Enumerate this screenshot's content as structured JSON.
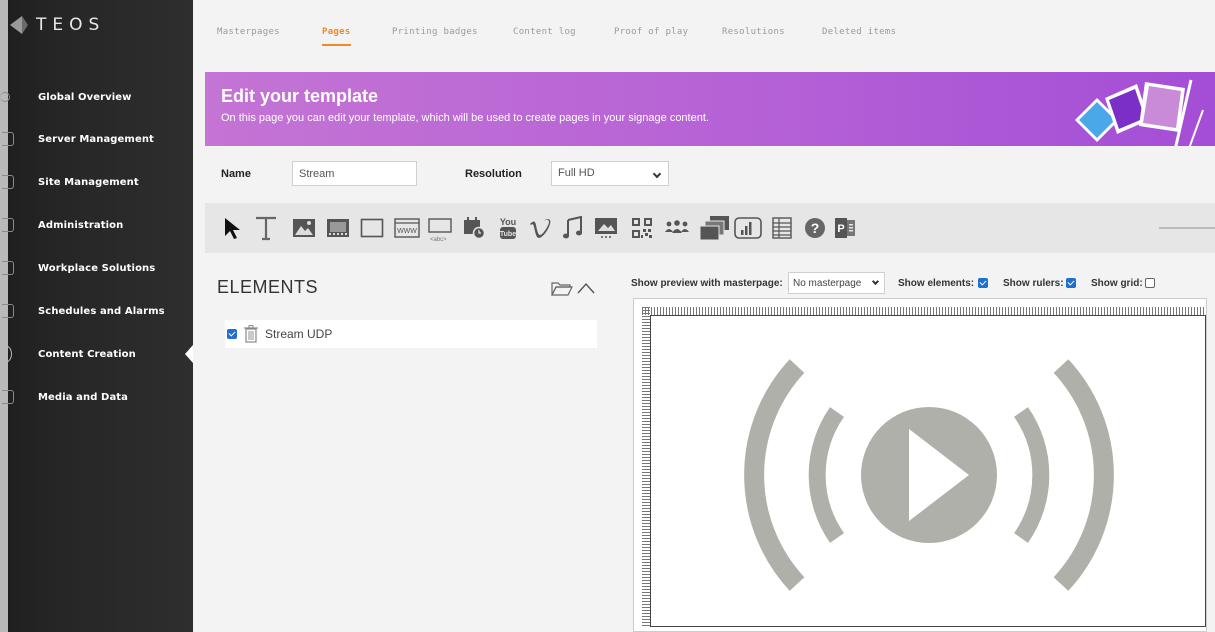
{
  "app": {
    "logo_text": "TEOS"
  },
  "sidebar": {
    "items": [
      {
        "label": "Global Overview",
        "icon": "gear-icon"
      },
      {
        "label": "Server Management",
        "icon": "server-icon"
      },
      {
        "label": "Site Management",
        "icon": "building-icon"
      },
      {
        "label": "Administration",
        "icon": "folder-icon"
      },
      {
        "label": "Workplace Solutions",
        "icon": "desk-icon"
      },
      {
        "label": "Schedules and Alarms",
        "icon": "bell-icon"
      },
      {
        "label": "Content Creation",
        "icon": "pencil-icon",
        "active": true
      },
      {
        "label": "Media and Data",
        "icon": "media-icon"
      }
    ]
  },
  "tabs": [
    {
      "label": "Masterpages"
    },
    {
      "label": "Pages",
      "active": true
    },
    {
      "label": "Printing badges"
    },
    {
      "label": "Content log"
    },
    {
      "label": "Proof of play"
    },
    {
      "label": "Resolutions"
    },
    {
      "label": "Deleted items"
    }
  ],
  "banner": {
    "title": "Edit your template",
    "subtitle": "On this page you can edit your template, which will be used to create pages in your signage content."
  },
  "form": {
    "name_label": "Name",
    "name_value": "Stream",
    "resolution_label": "Resolution",
    "resolution_value": "Full HD"
  },
  "toolbar": {
    "tools": [
      "select-arrow-icon",
      "text-icon",
      "image-icon",
      "video-icon",
      "rectangle-icon",
      "web-icon",
      "input-box-icon",
      "calendar-clock-icon",
      "youtube-icon",
      "vimeo-icon",
      "music-icon",
      "slideshow-icon",
      "qr-code-icon",
      "people-icon",
      "layers-icon",
      "chart-icon",
      "table-icon",
      "help-icon",
      "powerpoint-icon"
    ],
    "youtube_text": "You Tube",
    "web_text": "WWW",
    "input_text": "<abc>"
  },
  "elements": {
    "title": "ELEMENTS",
    "items": [
      {
        "label": "Stream UDP",
        "checked": true
      }
    ]
  },
  "preview": {
    "masterpage_label": "Show preview with masterpage:",
    "masterpage_value": "No masterpage",
    "show_elements_label": "Show elements:",
    "show_elements_checked": true,
    "show_rulers_label": "Show rulers:",
    "show_rulers_checked": true,
    "show_grid_label": "Show grid:",
    "show_grid_checked": false
  },
  "colors": {
    "accent_tab": "#f08a24",
    "banner_start": "#c474d4",
    "banner_end": "#a34ed6",
    "sidebar_bg": "#262626",
    "stream_icon": "#b0b0aa",
    "checkbox": "#1e6fd0"
  }
}
